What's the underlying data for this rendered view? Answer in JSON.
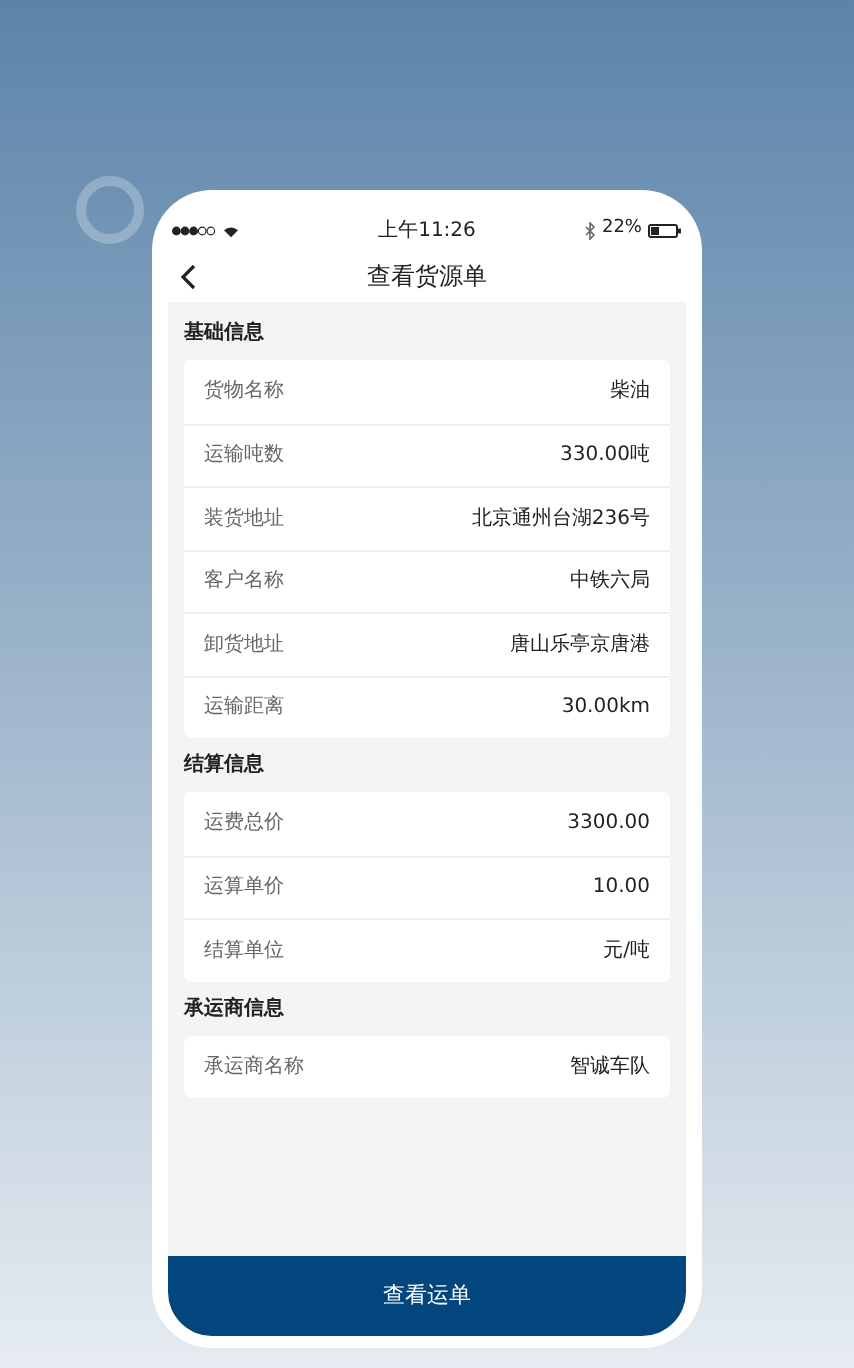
{
  "status_bar": {
    "time": "上午11:26",
    "battery": "22%"
  },
  "nav": {
    "title": "查看货源单"
  },
  "sections": [
    {
      "title": "基础信息",
      "rows": [
        {
          "label": "货物名称",
          "value": "柴油"
        },
        {
          "label": "运输吨数",
          "value": "330.00吨"
        },
        {
          "label": "装货地址",
          "value": "北京通州台湖236号"
        },
        {
          "label": "客户名称",
          "value": "中铁六局"
        },
        {
          "label": "卸货地址",
          "value": "唐山乐亭京唐港"
        },
        {
          "label": "运输距离",
          "value": "30.00km"
        }
      ]
    },
    {
      "title": "结算信息",
      "rows": [
        {
          "label": "运费总价",
          "value": "3300.00"
        },
        {
          "label": "运算单价",
          "value": "10.00"
        },
        {
          "label": "结算单位",
          "value": "元/吨"
        }
      ]
    },
    {
      "title": "承运商信息",
      "rows": [
        {
          "label": "承运商名称",
          "value": "智诚车队"
        }
      ]
    }
  ],
  "bottom_button": "查看运单"
}
